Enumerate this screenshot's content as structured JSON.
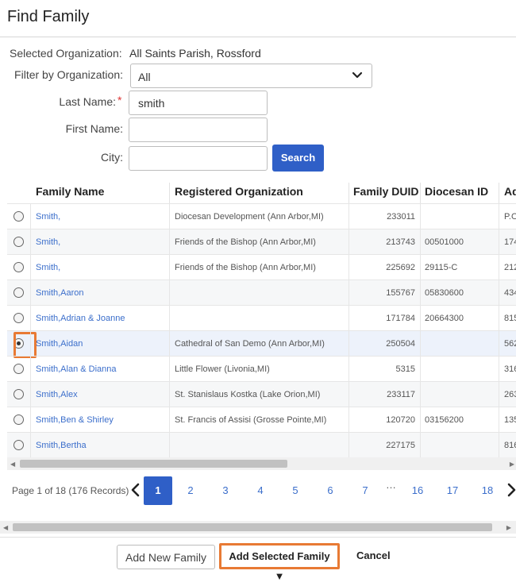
{
  "dialog": {
    "title": "Find Family"
  },
  "form": {
    "selected_org_label": "Selected Organization:",
    "selected_org_value": "All Saints Parish, Rossford",
    "filter_label": "Filter by Organization:",
    "filter_value": "All",
    "last_name_label": "Last Name:",
    "last_name_required": "*",
    "last_name_value": "smith",
    "first_name_label": "First Name:",
    "first_name_value": "",
    "city_label": "City:",
    "city_value": "",
    "search_label": "Search"
  },
  "table": {
    "columns": [
      "Family Name",
      "Registered Organization",
      "Family DUID",
      "Diocesan ID",
      "Ad"
    ],
    "rows": [
      {
        "name": "Smith,",
        "org": "Diocesan Development (Ann Arbor,MI)",
        "duid": "233011",
        "diocesan": "",
        "addr": "P.O",
        "selected": false
      },
      {
        "name": "Smith,",
        "org": "Friends of the Bishop (Ann Arbor,MI)",
        "duid": "213743",
        "diocesan": "00501000",
        "addr": "174",
        "selected": false
      },
      {
        "name": "Smith,",
        "org": "Friends of the Bishop (Ann Arbor,MI)",
        "duid": "225692",
        "diocesan": "29115-C",
        "addr": "212",
        "selected": false
      },
      {
        "name": "Smith,Aaron",
        "org": "",
        "duid": "155767",
        "diocesan": "05830600",
        "addr": "434",
        "selected": false
      },
      {
        "name": "Smith,Adrian & Joanne",
        "org": "",
        "duid": "171784",
        "diocesan": "20664300",
        "addr": "815",
        "selected": false
      },
      {
        "name": "Smith,Aidan",
        "org": "Cathedral of San Demo (Ann Arbor,MI)",
        "duid": "250504",
        "diocesan": "",
        "addr": "562",
        "selected": true
      },
      {
        "name": "Smith,Alan & Dianna",
        "org": "Little Flower (Livonia,MI)",
        "duid": "5315",
        "diocesan": "",
        "addr": "316",
        "selected": false
      },
      {
        "name": "Smith,Alex",
        "org": "St. Stanislaus Kostka (Lake Orion,MI)",
        "duid": "233117",
        "diocesan": "",
        "addr": "263",
        "selected": false
      },
      {
        "name": "Smith,Ben & Shirley",
        "org": "St. Francis of Assisi (Grosse Pointe,MI)",
        "duid": "120720",
        "diocesan": "03156200",
        "addr": "135",
        "selected": false
      },
      {
        "name": "Smith,Bertha",
        "org": "",
        "duid": "227175",
        "diocesan": "",
        "addr": "816",
        "selected": false
      }
    ]
  },
  "pager": {
    "summary": "Page 1 of 18 (176 Records)",
    "pages": [
      "1",
      "2",
      "3",
      "4",
      "5",
      "6",
      "7"
    ],
    "ellipsis": "…",
    "tail_pages": [
      "16",
      "17",
      "18"
    ],
    "current": "1"
  },
  "footer": {
    "add_new_label": "Add New Family",
    "add_selected_label": "Add Selected Family ▼",
    "cancel_label": "Cancel"
  },
  "colors": {
    "accent": "#2f5fc7",
    "link": "#3b6ecb",
    "highlight": "#e87a34"
  }
}
